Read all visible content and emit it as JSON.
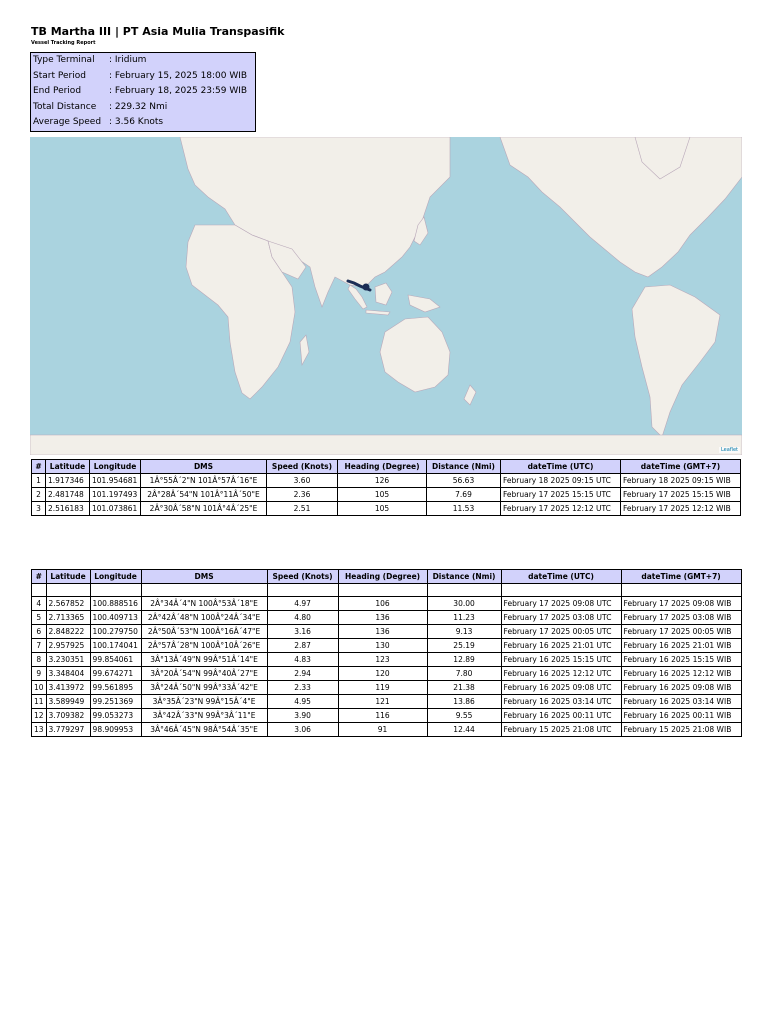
{
  "header": {
    "title": "TB Martha III | PT Asia Mulia Transpasifik",
    "subtitle": "Vessel Tracking Report"
  },
  "info": [
    {
      "label": "Type Terminal",
      "value": ": Iridium"
    },
    {
      "label": "Start Period",
      "value": ": February 15, 2025 18:00 WIB"
    },
    {
      "label": "End Period",
      "value": ": February 18, 2025 23:59 WIB"
    },
    {
      "label": "Total Distance",
      "value": ": 229.32 Nmi"
    },
    {
      "label": "Average Speed",
      "value": ": 3.56 Knots"
    }
  ],
  "map": {
    "attribution": "Leaflet",
    "colors": {
      "water": "#aad3df",
      "land": "#f2efe9",
      "border": "#b9a8b9",
      "track": "#1b2d55"
    }
  },
  "table": {
    "columns": [
      "#",
      "Latitude",
      "Longitude",
      "DMS",
      "Speed (Knots)",
      "Heading (Degree)",
      "Distance (Nmi)",
      "dateTime (UTC)",
      "dateTime (GMT+7)"
    ],
    "rows_page1": [
      [
        "1",
        "1.917346",
        "101.954681",
        "1Â°55Â´2\"N 101Â°57Â´16\"E",
        "3.60",
        "126",
        "56.63",
        "February 18 2025 09:15 UTC",
        "February 18 2025 09:15 WIB"
      ],
      [
        "2",
        "2.481748",
        "101.197493",
        "2Â°28Â´54\"N 101Â°11Â´50\"E",
        "2.36",
        "105",
        "7.69",
        "February 17 2025 15:15 UTC",
        "February 17 2025 15:15 WIB"
      ],
      [
        "3",
        "2.516183",
        "101.073861",
        "2Â°30Â´58\"N 101Â°4Â´25\"E",
        "2.51",
        "105",
        "11.53",
        "February 17 2025 12:12 UTC",
        "February 17 2025 12:12 WIB"
      ]
    ],
    "rows_page2": [
      [
        "4",
        "2.567852",
        "100.888516",
        "2Â°34Â´4\"N 100Â°53Â´18\"E",
        "4.97",
        "106",
        "30.00",
        "February 17 2025 09:08 UTC",
        "February 17 2025 09:08 WIB"
      ],
      [
        "5",
        "2.713365",
        "100.409713",
        "2Â°42Â´48\"N 100Â°24Â´34\"E",
        "4.80",
        "136",
        "11.23",
        "February 17 2025 03:08 UTC",
        "February 17 2025 03:08 WIB"
      ],
      [
        "6",
        "2.848222",
        "100.279750",
        "2Â°50Â´53\"N 100Â°16Â´47\"E",
        "3.16",
        "136",
        "9.13",
        "February 17 2025 00:05 UTC",
        "February 17 2025 00:05 WIB"
      ],
      [
        "7",
        "2.957925",
        "100.174041",
        "2Â°57Â´28\"N 100Â°10Â´26\"E",
        "2.87",
        "130",
        "25.19",
        "February 16 2025 21:01 UTC",
        "February 16 2025 21:01 WIB"
      ],
      [
        "8",
        "3.230351",
        "99.854061",
        "3Â°13Â´49\"N 99Â°51Â´14\"E",
        "4.83",
        "123",
        "12.89",
        "February 16 2025 15:15 UTC",
        "February 16 2025 15:15 WIB"
      ],
      [
        "9",
        "3.348404",
        "99.674271",
        "3Â°20Â´54\"N 99Â°40Â´27\"E",
        "2.94",
        "120",
        "7.80",
        "February 16 2025 12:12 UTC",
        "February 16 2025 12:12 WIB"
      ],
      [
        "10",
        "3.413972",
        "99.561895",
        "3Â°24Â´50\"N 99Â°33Â´42\"E",
        "2.33",
        "119",
        "21.38",
        "February 16 2025 09:08 UTC",
        "February 16 2025 09:08 WIB"
      ],
      [
        "11",
        "3.589949",
        "99.251369",
        "3Â°35Â´23\"N 99Â°15Â´4\"E",
        "4.95",
        "121",
        "13.86",
        "February 16 2025 03:14 UTC",
        "February 16 2025 03:14 WIB"
      ],
      [
        "12",
        "3.709382",
        "99.053273",
        "3Â°42Â´33\"N 99Â°3Â´11\"E",
        "3.90",
        "116",
        "9.55",
        "February 16 2025 00:11 UTC",
        "February 16 2025 00:11 WIB"
      ],
      [
        "13",
        "3.779297",
        "98.909953",
        "3Â°46Â´45\"N 98Â°54Â´35\"E",
        "3.06",
        "91",
        "12.44",
        "February 15 2025 21:08 UTC",
        "February 15 2025 21:08 WIB"
      ]
    ]
  }
}
